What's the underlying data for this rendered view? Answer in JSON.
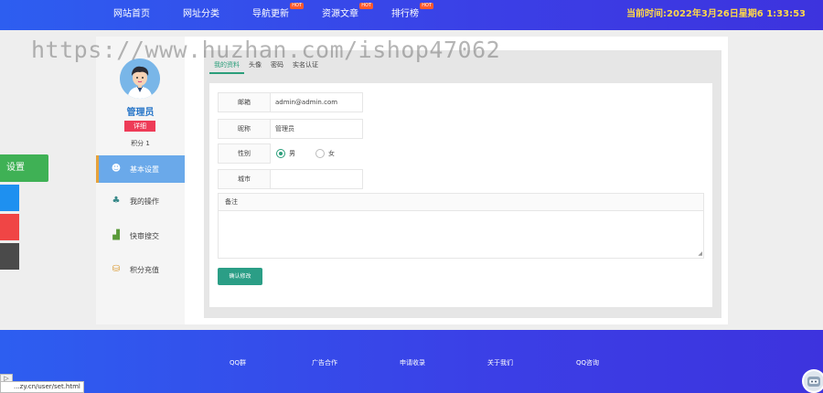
{
  "topbar": {
    "nav": [
      {
        "label": "网站首页",
        "badge": ""
      },
      {
        "label": "网址分类",
        "badge": ""
      },
      {
        "label": "导航更新",
        "badge": "HOT"
      },
      {
        "label": "资源文章",
        "badge": "HOT"
      },
      {
        "label": "排行榜",
        "badge": "HOT"
      }
    ],
    "clock": "当前时间:2022年3月26日星期6 1:33:53"
  },
  "watermark": "https://www.huzhan.com/ishop47062",
  "sidebar": {
    "user_name": "管理员",
    "user_badge": "详细",
    "user_points": "积分 1",
    "menu": [
      {
        "label": "基本设置",
        "icon": "avatar-settings-icon",
        "active": true
      },
      {
        "label": "我的操作",
        "icon": "gift-icon",
        "active": false
      },
      {
        "label": "快审搜交",
        "icon": "chart-icon",
        "active": false
      },
      {
        "label": "积分充值",
        "icon": "coins-icon",
        "active": false
      }
    ]
  },
  "tabs": [
    "我的资料",
    "头像",
    "密码",
    "实名认证"
  ],
  "form": {
    "email_label": "邮箱",
    "email_value": "admin@admin.com",
    "nickname_label": "昵称",
    "nickname_value": "管理员",
    "gender_label": "性别",
    "gender_male": "男",
    "gender_female": "女",
    "city_label": "城市",
    "city_value": "",
    "remark_label": "备注",
    "submit_label": "确认修改"
  },
  "float_main": "设置",
  "footer": {
    "links": [
      "QQ群",
      "广告合作",
      "申请收录",
      "关于我们",
      "QQ咨询"
    ]
  },
  "status_url": "...zy.cn/user/set.html",
  "colors": {
    "topbar": "#3b3fe6",
    "accent_green": "#2b9e86",
    "active_menu": "#6aa9ea",
    "badge_red": "#ee3b57",
    "clock_yellow": "#ffd84a"
  }
}
